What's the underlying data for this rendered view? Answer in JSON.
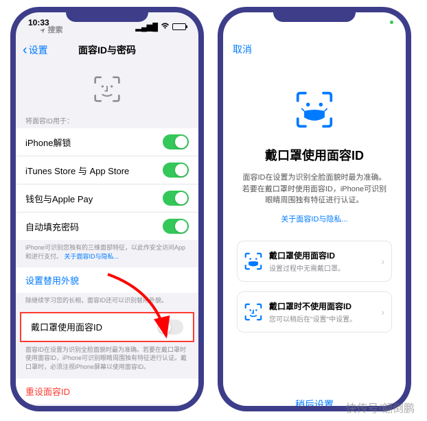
{
  "status": {
    "time": "10:33",
    "location_arrow": "➤"
  },
  "phone1": {
    "search_label": "搜索",
    "back": "设置",
    "title": "面容ID与密码",
    "section_use_for": "将面容ID用于：",
    "rows": {
      "unlock": "iPhone解锁",
      "itunes": "iTunes Store 与 App Store",
      "wallet": "钱包与Apple Pay",
      "autofill": "自动填充密码"
    },
    "footnote_access": "iPhone可识别您独有的三维面部特征，以此作安全访问App和进行支付。",
    "footnote_access_link": "关于面容ID与隐私...",
    "alt_appearance": "设置替用外貌",
    "alt_footnote": "除继续学习您的长相，面容ID还可以识别替用外貌。",
    "mask_row": "戴口罩使用面容ID",
    "mask_footnote": "面容ID在设置为识别全脸面貌时最为准确。若要在戴口罩时使用面容ID，iPhone可识别眼睛周围独有特征进行认证。戴口罩时，必须注视iPhone屏幕以使用面容ID。",
    "reset": "重设面容ID"
  },
  "phone2": {
    "cancel": "取消",
    "title": "戴口罩使用面容ID",
    "desc": "面容ID在设置为识别全脸面貌时最为准确。若要在戴口罩时使用面容ID，iPhone可识别眼睛周围独有特征进行认证。",
    "privacy_link": "关于面容ID与隐私...",
    "option1_title": "戴口罩使用面容ID",
    "option1_sub": "设置过程中无需戴口罩。",
    "option2_title": "戴口罩时不使用面容ID",
    "option2_sub": "您可以稍后在\"设置\"中设置。",
    "later": "稍后设置"
  },
  "watermark": "快传号/翩倒鹏"
}
